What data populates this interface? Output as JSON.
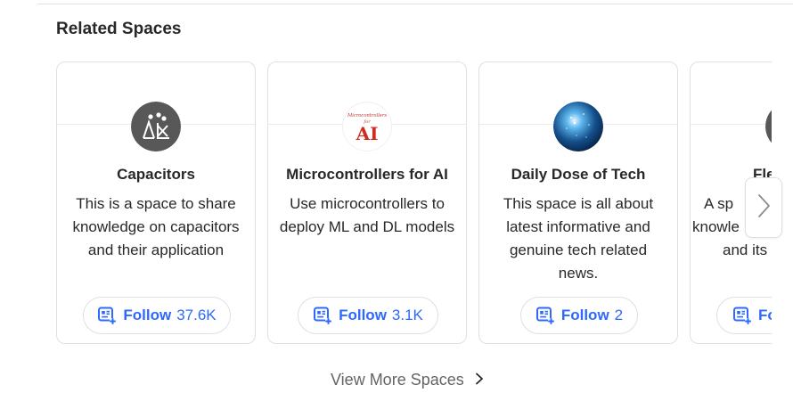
{
  "section": {
    "title": "Related Spaces"
  },
  "spaces": [
    {
      "name": "Capacitors",
      "description": "This is a space to share knowledge on capacitors and their application",
      "follow_label": "Follow",
      "followers": "37.6K",
      "avatar_icon": "capacitors-avatar"
    },
    {
      "name": "Microcontrollers for AI",
      "description": "Use microcontrollers to deploy ML and DL models",
      "follow_label": "Follow",
      "followers": "3.1K",
      "avatar_icon": "microcontrollers-avatar",
      "avatar_text_top": "Microcontrollers",
      "avatar_text_mid": "for",
      "avatar_text_main": "AI"
    },
    {
      "name": "Daily Dose of Tech",
      "description": "This space is all about latest informative and genuine tech related news.",
      "follow_label": "Follow",
      "followers": "2",
      "avatar_icon": "daily-dose-of-tech-avatar"
    },
    {
      "name": "Fle",
      "description": "A sp knowle and its",
      "description_lines": [
        "A sp",
        "knowle",
        "and its"
      ],
      "follow_label": "Fo",
      "avatar_icon": "partial-space-avatar"
    }
  ],
  "view_more": {
    "label": "View More Spaces"
  },
  "colors": {
    "accent": "#2e69ff",
    "text": "#282829",
    "muted": "#636466",
    "border": "#dee0e1"
  },
  "icons": {
    "follow": "follow-space-icon",
    "next": "chevron-right-icon",
    "view_more": "chevron-right-icon"
  }
}
